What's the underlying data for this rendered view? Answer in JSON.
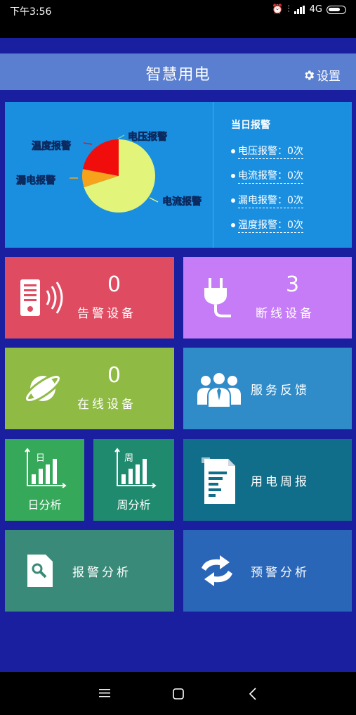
{
  "status_bar": {
    "time": "下午3:56",
    "network": "4G"
  },
  "header": {
    "title": "智慧用电",
    "settings_label": "设置"
  },
  "chart_data": {
    "type": "pie",
    "slices": [
      {
        "label": "电流报警",
        "value": 70,
        "color": "#e2f47a"
      },
      {
        "label": "漏电报警",
        "value": 8,
        "color": "#f7a21b"
      },
      {
        "label": "温度报警",
        "value": 22,
        "color": "#f20d0d"
      },
      {
        "label": "电压报警",
        "value": 0,
        "color": "#1aa0e0"
      }
    ]
  },
  "today_alarms": {
    "title": "当日报警",
    "items": [
      "电压报警：0次",
      "电流报警：0次",
      "漏电报警：0次",
      "温度报警：0次"
    ]
  },
  "tiles": {
    "alarm_devices": {
      "count": "0",
      "label": "告警设备",
      "color": "#df4c62"
    },
    "offline_devices": {
      "count": "3",
      "label": "断线设备",
      "color": "#c67cf7"
    },
    "online_devices": {
      "count": "0",
      "label": "在线设备",
      "color": "#8fba44"
    },
    "service_feedback": {
      "label": "服务反馈",
      "color": "#2f8cc9"
    },
    "day_analysis": {
      "icon_char": "日",
      "label": "日分析",
      "color": "#35a85a"
    },
    "week_analysis": {
      "icon_char": "周",
      "label": "周分析",
      "color": "#1f8a6e"
    },
    "weekly_report": {
      "label": "用电周报",
      "color": "#116e8a"
    },
    "alarm_analysis": {
      "label": "报警分析",
      "color": "#398a78"
    },
    "warning_analysis": {
      "label": "预警分析",
      "color": "#2a66b8"
    }
  }
}
